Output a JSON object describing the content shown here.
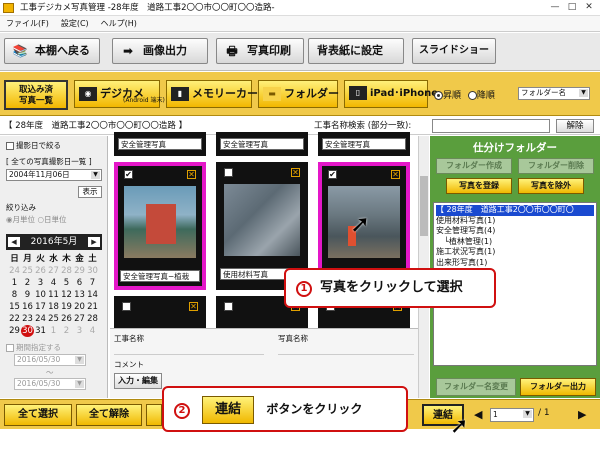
{
  "window": {
    "title": "工事デジカメ写真管理 -28年度　道路工事2〇〇市〇〇町〇〇造路-",
    "minimize": "—",
    "maximize": "□",
    "close": "✕"
  },
  "menu": [
    "ファイル(F)",
    "設定(C)",
    "ヘルプ(H)"
  ],
  "toolbar": {
    "back": "本棚へ戻る",
    "image_output": "画像出力",
    "photo_print": "写真印刷",
    "cover_settings": "背表紙に設定",
    "slideshow": "スライドショー"
  },
  "sources": {
    "imported": "取込み済\n写真一覧",
    "digicam": "デジカメ",
    "digicam_sub": "(Android 端末)",
    "memory_card": "メモリーカード",
    "folder": "フォルダー",
    "ipad": "iPad･iPhone",
    "asc": "昇順",
    "desc": "降順",
    "sort_value": "フォルダー名"
  },
  "search": {
    "folder_label": "【 28年度　道路工事2〇〇市〇〇町〇〇造路 】",
    "search_label": "工事名称検索 (部分一致):",
    "search_value": "",
    "clear": "解除"
  },
  "left": {
    "date_filter": "撮影日で絞る",
    "all_dates": "[ 全ての写真撮影日一覧 ]",
    "date_value": "2004年11月06日",
    "show": "表示",
    "narrow": "絞り込み",
    "by_month": "月単位",
    "by_day": "日単位",
    "year_month": "2016年5月",
    "prev": "◀",
    "next": "▶",
    "weekdays": [
      "日",
      "月",
      "火",
      "水",
      "木",
      "金",
      "土"
    ],
    "days": [
      "24",
      "25",
      "26",
      "27",
      "28",
      "29",
      "30",
      "1",
      "2",
      "3",
      "4",
      "5",
      "6",
      "7",
      "8",
      "9",
      "10",
      "11",
      "12",
      "13",
      "14",
      "15",
      "16",
      "17",
      "18",
      "19",
      "20",
      "21",
      "22",
      "23",
      "24",
      "25",
      "26",
      "27",
      "28",
      "29",
      "30",
      "31",
      "1",
      "2",
      "3",
      "4"
    ],
    "today": "30",
    "period": "期間指定する",
    "from": "2016/05/30",
    "tilde": "〜",
    "to": "2016/05/30"
  },
  "photos": {
    "top_captions": [
      "安全管理写真",
      "安全管理写真",
      "安全管理写真"
    ],
    "row2": [
      {
        "caption": "安全管理写真−植栽",
        "checked": "✔"
      },
      {
        "caption": "使用材料写真",
        "checked": ""
      },
      {
        "caption": "",
        "checked": "✔"
      }
    ]
  },
  "info": {
    "construction_name": "工事名称",
    "photo_name": "写真名称",
    "comment": "コメント",
    "edit": "入力・編集"
  },
  "right": {
    "title": "仕分けフォルダー",
    "create": "フォルダー作成",
    "delete": "フォルダー削除",
    "register": "写真を登録",
    "remove": "写真を除外",
    "tree": [
      "【 28年度　道路工事2〇〇市〇〇町〇",
      "使用材料写真(1)",
      "安全管理写真(4)",
      "　└植林管理(1)",
      "施工状況写真(1)",
      "出来形写真(1)"
    ],
    "rename": "フォルダー名変更",
    "output": "フォルダー出力"
  },
  "bottom": {
    "select_all": "全て選択",
    "deselect_all": "全て解除",
    "link": "連結",
    "page_value": "1",
    "page_total": "/ 1"
  },
  "callouts": {
    "step1_num": "1",
    "step1": "写真をクリックして選択",
    "step2_num": "2",
    "step2_btn": "連結",
    "step2": "ボタンをクリック"
  },
  "colors": {
    "accent": "#f0c94a",
    "magenta": "#e417c8",
    "green": "#5a9e3d",
    "red": "#d01010"
  }
}
